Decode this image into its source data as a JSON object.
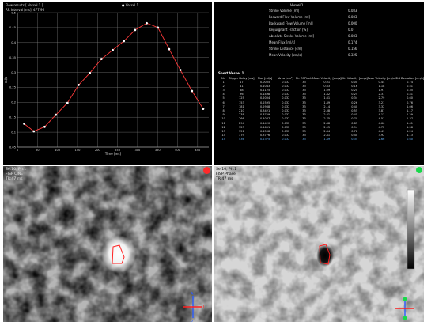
{
  "graph": {
    "title_line1": "Flow results [ Vessel 1 ]",
    "title_line2": "RR Interval [ms]: 477.96",
    "legend": "Vessel 1",
    "x_label": "Time [ms]",
    "y_label": "ml/s",
    "x_ticks": [
      "0",
      "50",
      "100",
      "150",
      "200",
      "250",
      "300",
      "350",
      "400",
      "450"
    ],
    "y_ticks": [
      "0.5",
      "0.45",
      "0.4",
      "0.35",
      "0.3",
      "0.25",
      "0.2",
      "0.15",
      "0.1",
      "0.05"
    ],
    "line_color": "#ff3a3a",
    "point_color": "#ffffff"
  },
  "chart_data": {
    "type": "line",
    "x": [
      17,
      41,
      68,
      96,
      125,
      153,
      181,
      210,
      238,
      266,
      294,
      323,
      351,
      379,
      407,
      436,
      464
    ],
    "series": [
      {
        "name": "Vessel 1",
        "values": [
          0.128,
          0.103,
          0.118,
          0.158,
          0.198,
          0.258,
          0.298,
          0.345,
          0.375,
          0.405,
          0.442,
          0.465,
          0.45,
          0.378,
          0.308,
          0.238,
          0.178
        ]
      }
    ],
    "xlabel": "Time [ms]",
    "ylabel": "ml/s",
    "xlim": [
      0,
      478
    ],
    "ylim": [
      0.05,
      0.5
    ]
  },
  "summary": {
    "vessel": "Vessel 1",
    "rows": [
      {
        "label": "Stroke Volume [ml]",
        "value": "0.083"
      },
      {
        "label": "Forward Flow Volume [ml]",
        "value": "0.083"
      },
      {
        "label": "Backward Flow Volume [ml]",
        "value": "0.000"
      },
      {
        "label": "Regurgitant Fraction [%]",
        "value": "0.0"
      },
      {
        "label": "Absolute Stroke Volume [ml]",
        "value": "0.083"
      },
      {
        "label": "Mean Flux [ml/s]",
        "value": "0.174"
      },
      {
        "label": "Stroke Distance [cm]",
        "value": "0.156"
      },
      {
        "label": "Mean Velocity [cm/s]",
        "value": "0.325"
      }
    ]
  },
  "table": {
    "title": "Short Vessel 1",
    "headers": [
      "Nr.",
      "Trigger Delay [ms]",
      "Flux [ml/s]",
      "Area [cm²]",
      "Nr. Of Pixels",
      "Mean Velocity [cm/s]",
      "Min Velocity [cm/s]",
      "Peak Velocity [cm/s]",
      "Std Deviation [cm/s]"
    ],
    "rows": [
      [
        "1",
        "17",
        "0.0005",
        "0.032",
        "33",
        "0.01",
        "0.00",
        "0.44",
        "0.74"
      ],
      [
        "2",
        "41",
        "0.1043",
        "0.032",
        "33",
        "0.63",
        "0.16",
        "1.18",
        "0.51"
      ],
      [
        "3",
        "68",
        "0.1125",
        "0.032",
        "33",
        "1.09",
        "0.20",
        "1.97",
        "0.35"
      ],
      [
        "4",
        "96",
        "0.1498",
        "0.032",
        "33",
        "1.42",
        "0.25",
        "2.31",
        "0.41"
      ],
      [
        "5",
        "125",
        "0.2004",
        "0.032",
        "33",
        "1.61",
        "0.34",
        "2.79",
        "0.60"
      ],
      [
        "6",
        "153",
        "0.2595",
        "0.032",
        "33",
        "1.89",
        "0.26",
        "3.21",
        "0.76"
      ],
      [
        "7",
        "181",
        "0.2968",
        "0.032",
        "33",
        "2.14",
        "0.40",
        "3.32",
        "1.06"
      ],
      [
        "8",
        "210",
        "0.3421",
        "0.032",
        "33",
        "2.38",
        "0.55",
        "3.87",
        "1.17"
      ],
      [
        "9",
        "238",
        "0.3759",
        "0.032",
        "33",
        "2.61",
        "0.45",
        "4.13",
        "1.29"
      ],
      [
        "10",
        "266",
        "0.4087",
        "0.032",
        "33",
        "2.75",
        "0.70",
        "4.51",
        "1.37"
      ],
      [
        "11",
        "294",
        "0.4420",
        "0.032",
        "33",
        "2.88",
        "0.85",
        "4.66",
        "1.41"
      ],
      [
        "12",
        "323",
        "0.4651",
        "0.032",
        "33",
        "2.95",
        "0.94",
        "4.72",
        "1.58"
      ],
      [
        "13",
        "351",
        "0.4508",
        "0.032",
        "33",
        "2.84",
        "0.78",
        "4.49",
        "1.24"
      ],
      [
        "14",
        "379",
        "0.3776",
        "0.032",
        "33",
        "2.41",
        "0.40",
        "3.92",
        "1.13"
      ],
      [
        "15",
        "436",
        "0.2375",
        "0.032",
        "33",
        "1.49",
        "0.35",
        "2.66",
        "0.60"
      ]
    ],
    "selected_row": 14
  },
  "viewports": {
    "left": {
      "line1": "Se:10, Ph:1",
      "line2": "FISP CINE",
      "line3": "TR:47 ms",
      "mag_note": "Magnitude"
    },
    "right": {
      "line1": "Se:10, Ph:1",
      "line2": "FISP Phase",
      "line3": "TR:47 ms"
    }
  },
  "colors": {
    "roi": "#ff2020",
    "pointer_red": "#ff2a2a",
    "pointer_green": "#18d84a",
    "orientation_blue": "#2a5cff",
    "orientation_red": "#ff2020"
  },
  "icons": [
    "close-icon",
    "maximize-icon",
    "orientation-axes-icon",
    "colorbar-icon"
  ]
}
